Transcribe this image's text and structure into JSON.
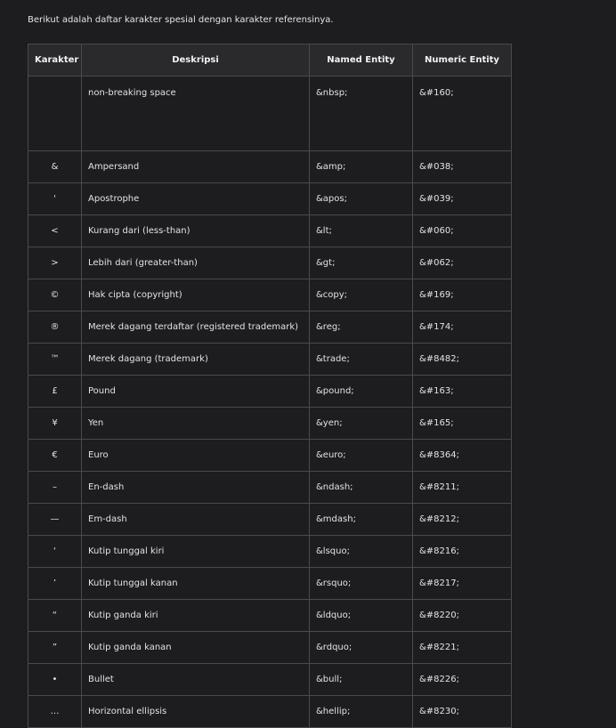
{
  "intro": "Berikut adalah daftar karakter spesial dengan karakter referensinya.",
  "table": {
    "headers": [
      "Karakter",
      "Deskripsi",
      "Named Entity",
      "Numeric Entity"
    ],
    "rows": [
      {
        "char": "",
        "desc": "non-breaking space",
        "named": "&nbsp;",
        "numeric": "&#160;"
      },
      {
        "char": "&",
        "desc": "Ampersand",
        "named": "&amp;",
        "numeric": "&#038;"
      },
      {
        "char": "'",
        "desc": "Apostrophe",
        "named": "&apos;",
        "numeric": "&#039;"
      },
      {
        "char": "<",
        "desc": "Kurang dari (less-than)",
        "named": "&lt;",
        "numeric": "&#060;"
      },
      {
        "char": ">",
        "desc": "Lebih dari (greater-than)",
        "named": "&gt;",
        "numeric": "&#062;"
      },
      {
        "char": "©",
        "desc": "Hak cipta (copyright)",
        "named": "&copy;",
        "numeric": "&#169;"
      },
      {
        "char": "®",
        "desc": "Merek dagang terdaftar (registered trademark)",
        "named": "&reg;",
        "numeric": "&#174;"
      },
      {
        "char": "™",
        "desc": "Merek dagang (trademark)",
        "named": "&trade;",
        "numeric": "&#8482;"
      },
      {
        "char": "£",
        "desc": "Pound",
        "named": "&pound;",
        "numeric": "&#163;"
      },
      {
        "char": "¥",
        "desc": "Yen",
        "named": "&yen;",
        "numeric": "&#165;"
      },
      {
        "char": "€",
        "desc": "Euro",
        "named": "&euro;",
        "numeric": "&#8364;"
      },
      {
        "char": "–",
        "desc": "En-dash",
        "named": "&ndash;",
        "numeric": "&#8211;"
      },
      {
        "char": "—",
        "desc": "Em-dash",
        "named": "&mdash;",
        "numeric": "&#8212;"
      },
      {
        "char": "‘",
        "desc": "Kutip tunggal kiri",
        "named": "&lsquo;",
        "numeric": "&#8216;"
      },
      {
        "char": "’",
        "desc": "Kutip tunggal kanan",
        "named": "&rsquo;",
        "numeric": "&#8217;"
      },
      {
        "char": "“",
        "desc": "Kutip ganda kiri",
        "named": "&ldquo;",
        "numeric": "&#8220;"
      },
      {
        "char": "”",
        "desc": "Kutip ganda kanan",
        "named": "&rdquo;",
        "numeric": "&#8221;"
      },
      {
        "char": "•",
        "desc": "Bullet",
        "named": "&bull;",
        "numeric": "&#8226;"
      },
      {
        "char": "…",
        "desc": "Horizontal ellipsis",
        "named": "&hellip;",
        "numeric": "&#8230;"
      }
    ]
  }
}
